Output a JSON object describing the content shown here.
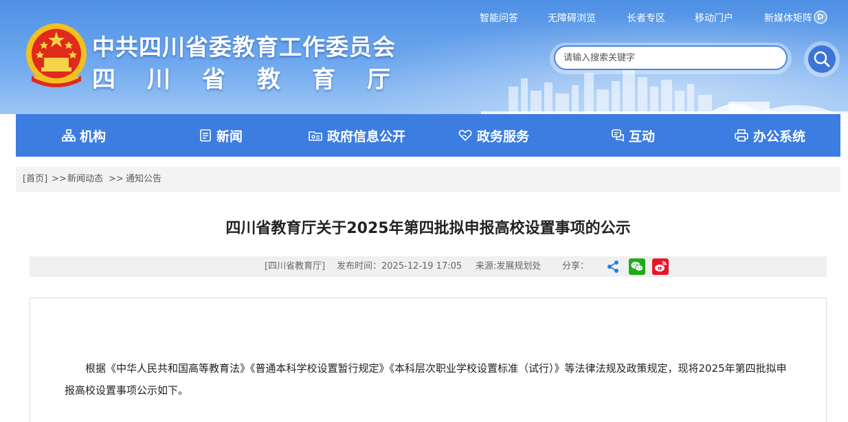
{
  "header": {
    "title_main": "中共四川省委教育工作委员会",
    "title_sub": "四川省教育厅",
    "top_links": [
      "智能问答",
      "无障碍浏览",
      "长者专区",
      "移动门户",
      "新媒体矩阵"
    ],
    "search_placeholder": "请输入搜索关键字"
  },
  "nav": {
    "items": [
      {
        "label": "机构",
        "icon": "org-chart-icon"
      },
      {
        "label": "新闻",
        "icon": "news-icon"
      },
      {
        "label": "政府信息公开",
        "icon": "info-folder-icon"
      },
      {
        "label": "政务服务",
        "icon": "heart-hand-icon"
      },
      {
        "label": "互动",
        "icon": "chat-icon"
      },
      {
        "label": "办公系统",
        "icon": "printer-icon"
      }
    ]
  },
  "breadcrumb": {
    "home": "[首页]",
    "sep": ">>",
    "level1": "新闻动态",
    "level2": "通知公告"
  },
  "article": {
    "title": "四川省教育厅关于2025年第四批拟申报高校设置事项的公示",
    "source": "[四川省教育厅]",
    "published": "发布时间：2025-12-19 17:05",
    "origin": "来源:发展规划处",
    "share_label": "分享：",
    "paragraph": "根据《中华人民共和国高等教育法》《普通本科学校设置暂行规定》《本科层次职业学校设置标准（试行）》等法律法规及政策规定，现将2025年第四批拟申报高校设置事项公示如下。"
  },
  "colors": {
    "nav_bg": "#3d7de1",
    "header_top": "#4e90e4",
    "wechat": "#1aad19",
    "weibo": "#e6162d",
    "share": "#2a7de1"
  }
}
